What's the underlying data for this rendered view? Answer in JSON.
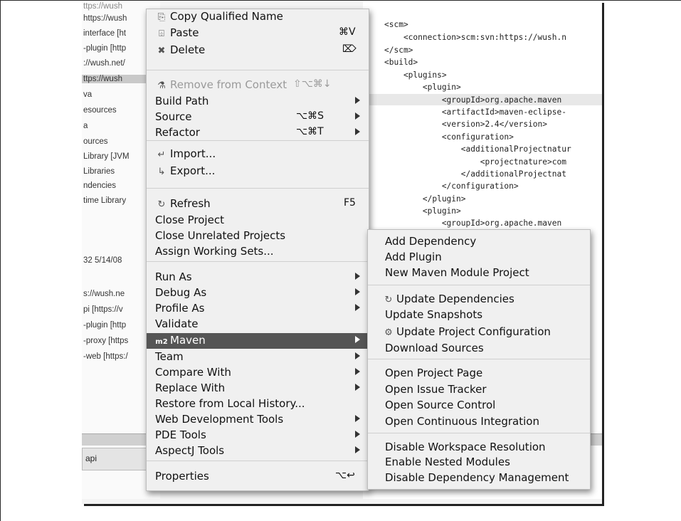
{
  "explorer": {
    "lines": [
      "ttps://wush",
      "https://wush",
      "interface [ht",
      "-plugin [http",
      "://wush.net/",
      "ttps://wush",
      "va",
      "esources",
      "a",
      "ources",
      "Library [JVM",
      "Libraries",
      "ndencies",
      "time Library",
      "32 5/14/08",
      "s://wush.ne",
      "pi [https://v",
      "-plugin [http",
      "-proxy [https",
      "-web [https:/"
    ],
    "tab_label": "api"
  },
  "editor": {
    "lines": [
      "<scm>",
      "    <connection>scm:svn:https://wush.n",
      "</scm>",
      "<build>",
      "    <plugins>",
      "        <plugin>",
      "            <groupId>org.apache.maven",
      "            <artifactId>maven-eclipse-",
      "            <version>2.4</version>",
      "            <configuration>",
      "                <additionalProjectnatur",
      "                    <projectnature>com",
      "                </additionalProjectnat",
      "            </configuration>",
      "        </plugin>",
      "        <plugin>",
      "            <groupId>org.apache.maven"
    ]
  },
  "context_menu": {
    "items": [
      {
        "label": "Copy Qualified Name",
        "icon": "copy-icon",
        "glyph": "⎘"
      },
      {
        "label": "Paste",
        "icon": "paste-icon",
        "glyph": "⌹",
        "shortcut": "⌘V"
      },
      {
        "label": "Delete",
        "icon": "delete-icon",
        "glyph": "✖",
        "shortcut": "⌦"
      },
      {
        "label": "Remove from Context",
        "icon": "remove-context-icon",
        "glyph": "⚗",
        "shortcut": "⇧⌥⌘↓",
        "disabled": true
      },
      {
        "label": "Build Path"
      },
      {
        "label": "Source",
        "shortcut": "⌥⌘S"
      },
      {
        "label": "Refactor",
        "shortcut": "⌥⌘T"
      },
      {
        "label": "Import...",
        "icon": "import-icon",
        "glyph": "↵"
      },
      {
        "label": "Export...",
        "icon": "export-icon",
        "glyph": "↳"
      },
      {
        "label": "Refresh",
        "icon": "refresh-icon",
        "glyph": "↻",
        "shortcut": "F5"
      },
      {
        "label": "Close Project"
      },
      {
        "label": "Close Unrelated Projects"
      },
      {
        "label": "Assign Working Sets..."
      },
      {
        "label": "Run As"
      },
      {
        "label": "Debug As"
      },
      {
        "label": "Profile As"
      },
      {
        "label": "Validate"
      },
      {
        "label": "Maven",
        "icon": "maven-icon",
        "glyph": "m2",
        "active": true
      },
      {
        "label": "Team"
      },
      {
        "label": "Compare With"
      },
      {
        "label": "Replace With"
      },
      {
        "label": "Restore from Local History..."
      },
      {
        "label": "Web Development Tools"
      },
      {
        "label": "PDE Tools"
      },
      {
        "label": "AspectJ Tools"
      },
      {
        "label": "Properties",
        "shortcut": "⌥↩"
      }
    ]
  },
  "maven_submenu": {
    "items": [
      {
        "label": "Add Dependency"
      },
      {
        "label": "Add Plugin"
      },
      {
        "label": "New Maven Module Project"
      },
      {
        "label": "Update Dependencies",
        "icon": "update-dependencies-icon",
        "glyph": "↻"
      },
      {
        "label": "Update Snapshots"
      },
      {
        "label": "Update Project Configuration",
        "icon": "update-config-icon",
        "glyph": "⚙"
      },
      {
        "label": "Download Sources"
      },
      {
        "label": "Open Project Page"
      },
      {
        "label": "Open Issue Tracker"
      },
      {
        "label": "Open Source Control"
      },
      {
        "label": "Open Continuous Integration"
      },
      {
        "label": "Disable Workspace Resolution"
      },
      {
        "label": "Enable Nested Modules"
      },
      {
        "label": "Disable Dependency Management"
      }
    ]
  }
}
